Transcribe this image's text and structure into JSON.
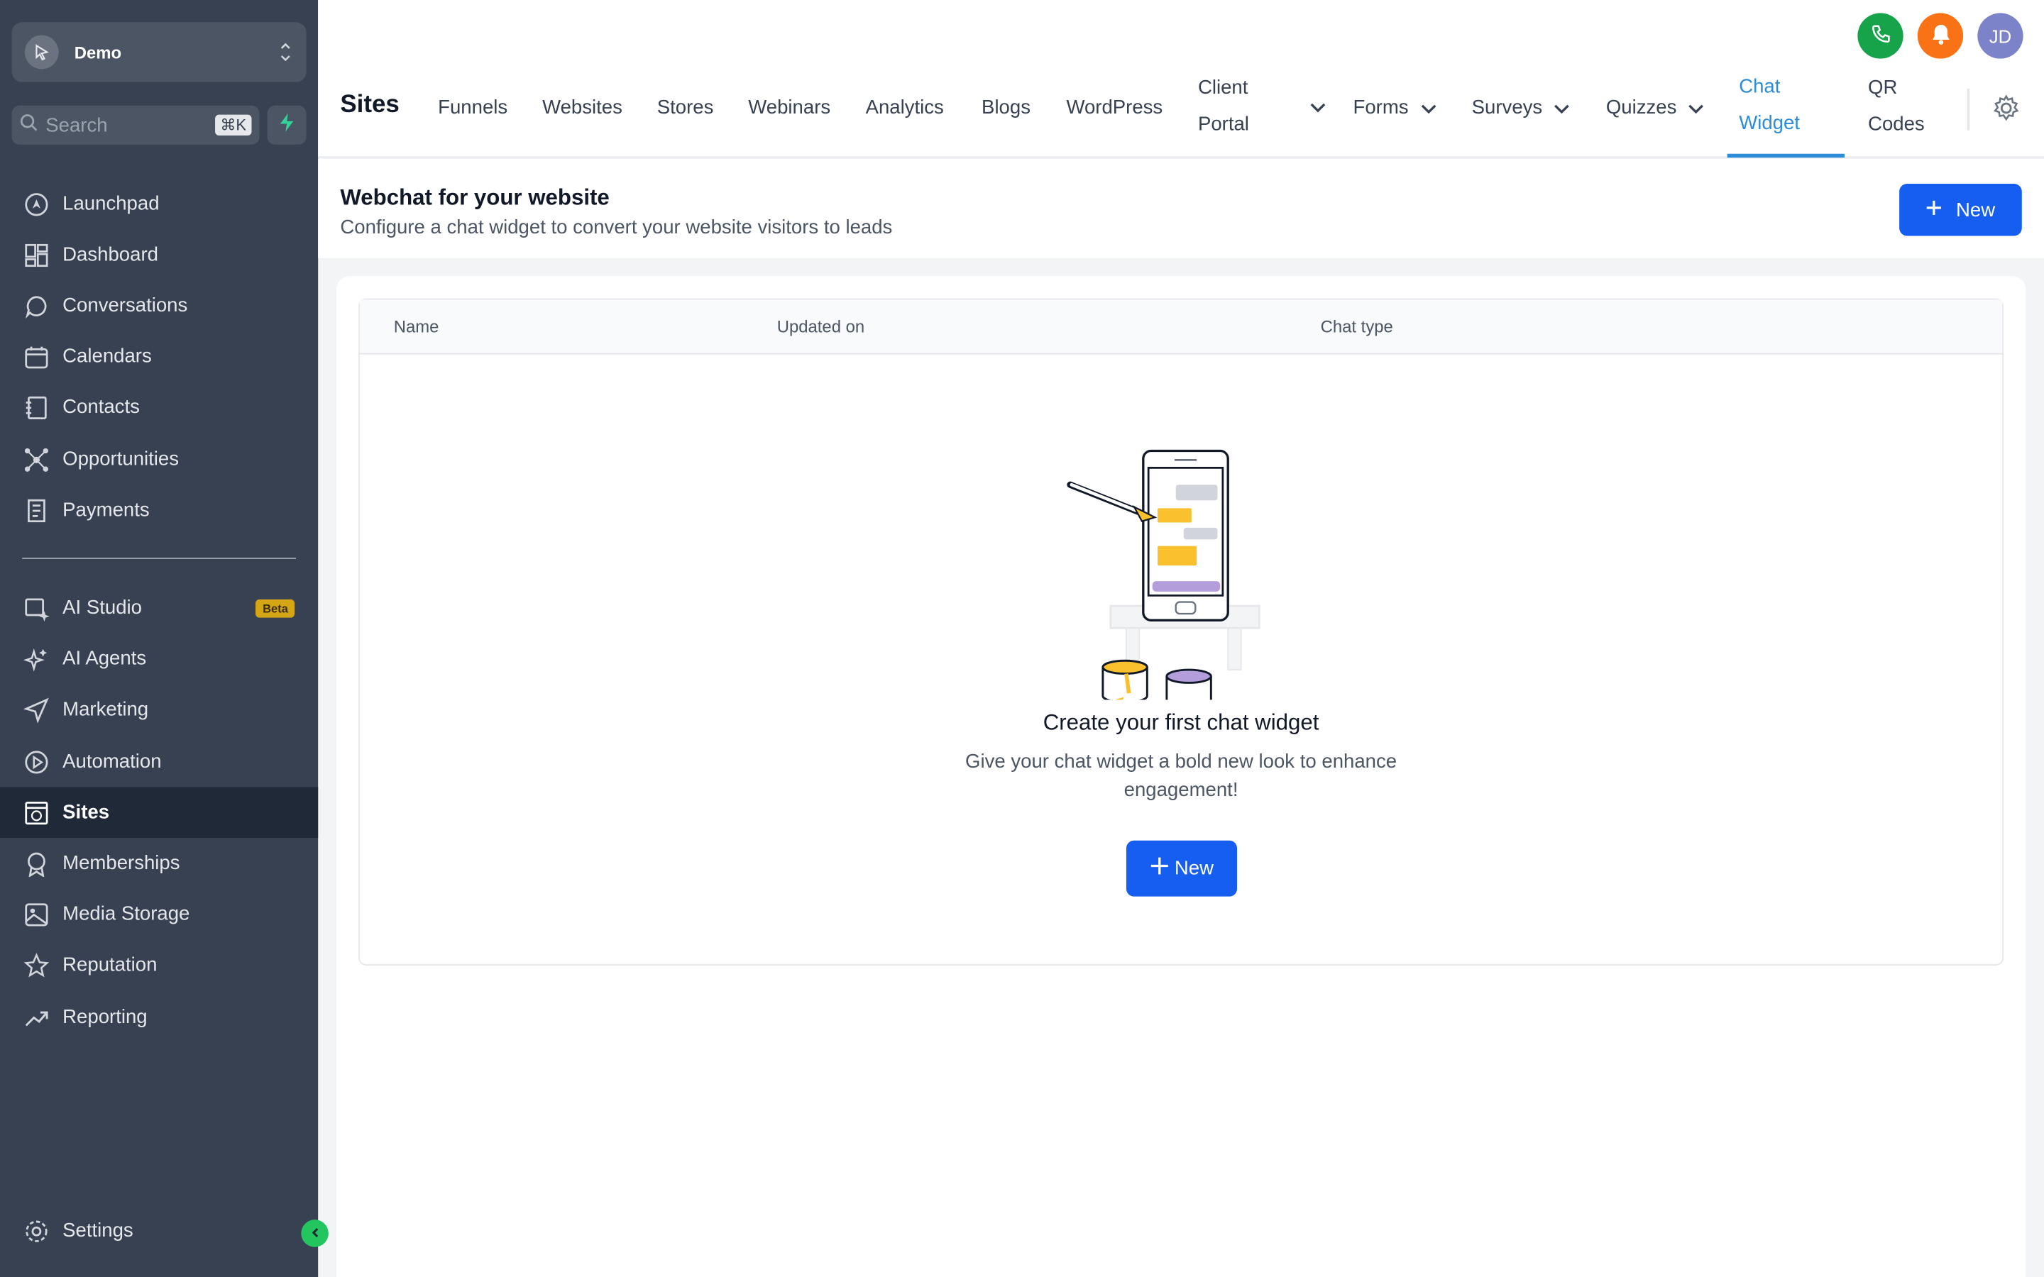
{
  "account": {
    "name": "Demo"
  },
  "search": {
    "placeholder": "Search",
    "shortcut": "⌘K"
  },
  "sidebar": {
    "items": [
      {
        "label": "Launchpad",
        "icon": "rocket-icon"
      },
      {
        "label": "Dashboard",
        "icon": "grid-icon"
      },
      {
        "label": "Conversations",
        "icon": "chat-bubble-icon"
      },
      {
        "label": "Calendars",
        "icon": "calendar-icon"
      },
      {
        "label": "Contacts",
        "icon": "contact-book-icon"
      },
      {
        "label": "Opportunities",
        "icon": "network-icon"
      },
      {
        "label": "Payments",
        "icon": "receipt-icon"
      }
    ],
    "items2": [
      {
        "label": "AI Studio",
        "icon": "ai-studio-icon",
        "badge": "Beta"
      },
      {
        "label": "AI Agents",
        "icon": "sparkle-icon"
      },
      {
        "label": "Marketing",
        "icon": "send-icon"
      },
      {
        "label": "Automation",
        "icon": "play-circle-icon"
      },
      {
        "label": "Sites",
        "icon": "globe-window-icon",
        "active": true
      },
      {
        "label": "Memberships",
        "icon": "award-icon"
      },
      {
        "label": "Media Storage",
        "icon": "image-icon"
      },
      {
        "label": "Reputation",
        "icon": "star-icon"
      },
      {
        "label": "Reporting",
        "icon": "trend-icon"
      }
    ],
    "settings": "Settings"
  },
  "topbar": {
    "avatar": "JD",
    "title": "Sites",
    "tabs": {
      "funnels": "Funnels",
      "websites": "Websites",
      "stores": "Stores",
      "webinars": "Webinars",
      "analytics": "Analytics",
      "blogs": "Blogs",
      "wordpress": "WordPress",
      "client_portal_1": "Client",
      "client_portal_2": "Portal",
      "forms": "Forms",
      "surveys": "Surveys",
      "quizzes": "Quizzes",
      "chat_widget_1": "Chat",
      "chat_widget_2": "Widget",
      "qr_codes_1": "QR",
      "qr_codes_2": "Codes"
    }
  },
  "header": {
    "title": "Webchat for your website",
    "subtitle": "Configure a chat widget to convert your website visitors to leads",
    "new_label": "New"
  },
  "table": {
    "columns": [
      "Name",
      "Updated on",
      "Chat type"
    ]
  },
  "empty": {
    "title": "Create your first chat widget",
    "description": "Give your chat widget a bold new look to enhance engagement!",
    "new_label": "New"
  },
  "colors": {
    "primary": "#155eef",
    "sidebar": "#374151",
    "active_tab": "#2d8cd8"
  }
}
